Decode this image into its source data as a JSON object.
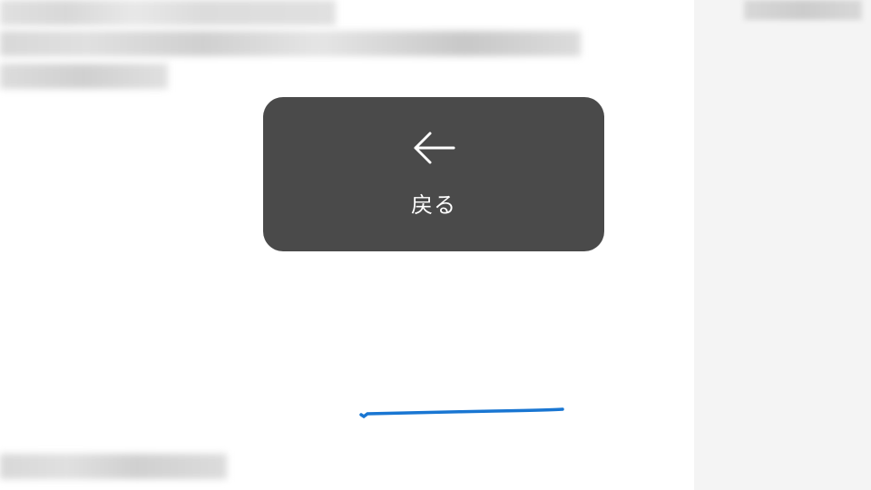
{
  "toast": {
    "back_label": "戻る",
    "icon_name": "arrow-left"
  },
  "colors": {
    "toast_bg": "#4a4a4a",
    "toast_fg": "#ffffff",
    "annotation": "#1976d2",
    "sidebar_bg": "#f4f4f4"
  }
}
